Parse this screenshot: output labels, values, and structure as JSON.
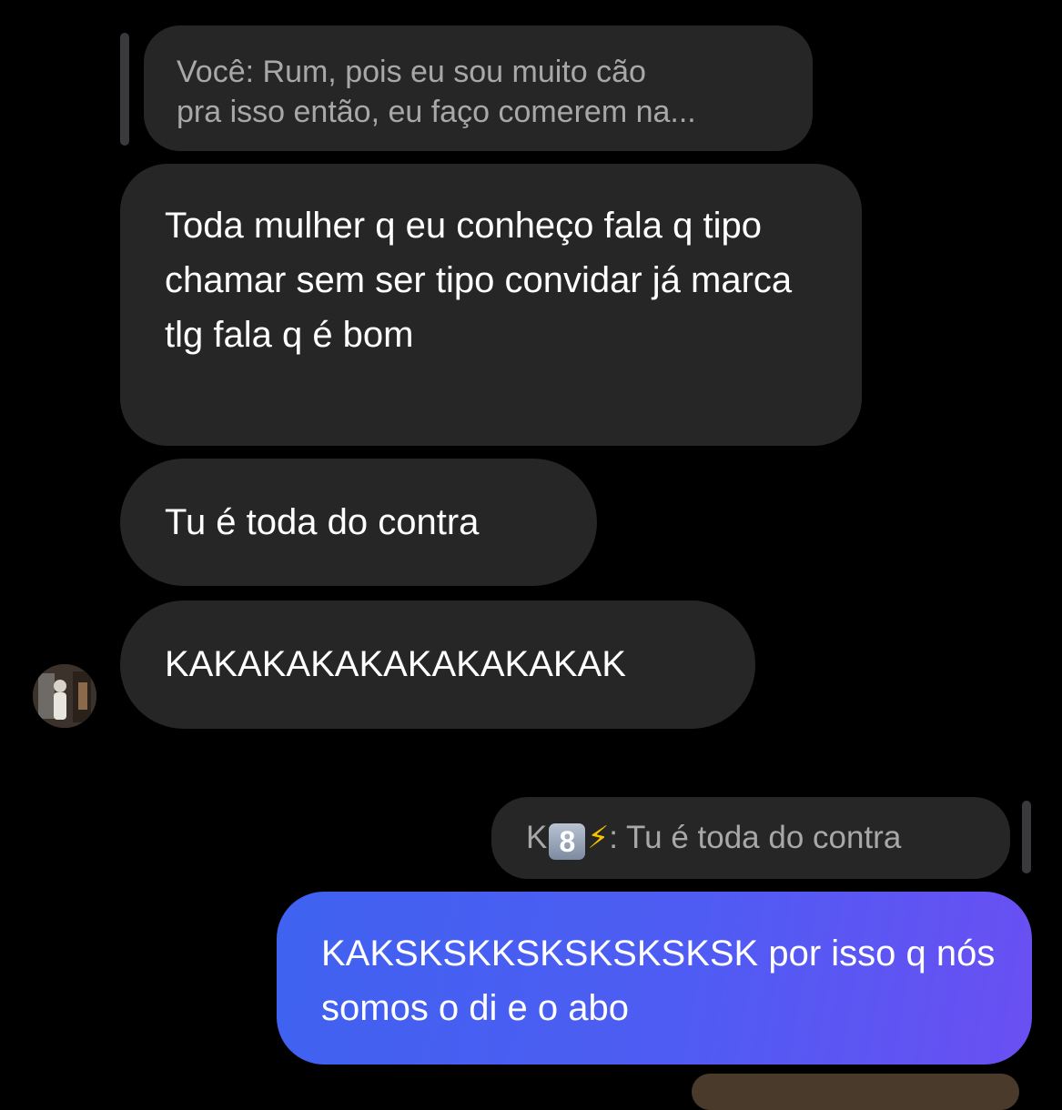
{
  "received_reply": {
    "text_line1": "Você: Rum, pois eu sou muito cão",
    "text_line2": "pra isso então, eu faço comerem na..."
  },
  "messages_received": [
    {
      "text": "Toda mulher q eu conheço fala q tipo chamar sem ser tipo convidar já marca tlg fala q é bom"
    },
    {
      "text": "Tu é toda do contra"
    },
    {
      "text": "KAKAKAKAKAKAKAKAKAK"
    }
  ],
  "sent_reply": {
    "prefix": "K",
    "key_emoji": "8",
    "bolt_emoji": "⚡",
    "text": ": Tu é toda do contra"
  },
  "message_sent": {
    "text": "KAKSKSKKSKSKSKSKSK por isso q nós somos o di e o abo"
  },
  "colors": {
    "background": "#000000",
    "received_bubble": "#262626",
    "reply_text": "#a8a8a8",
    "sent_gradient_start": "#3f62f0",
    "sent_gradient_end": "#6a4ff3"
  },
  "icons": {
    "avatar": "contact-avatar-photo",
    "key_emoji": "keycap-8-emoji",
    "bolt_emoji": "high-voltage-emoji"
  }
}
